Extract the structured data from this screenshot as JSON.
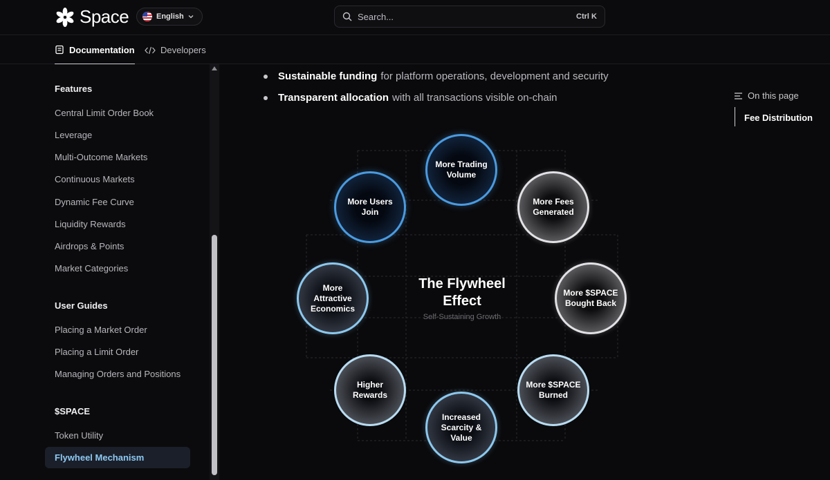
{
  "header": {
    "logo_text": "Space",
    "language": "English",
    "search_placeholder": "Search...",
    "search_shortcut": "Ctrl K"
  },
  "nav_tabs": [
    {
      "label": "Documentation",
      "active": true
    },
    {
      "label": "Developers",
      "active": false
    }
  ],
  "sidebar": {
    "sections": [
      {
        "title": "Features",
        "items": [
          "Central Limit Order Book",
          "Leverage",
          "Multi-Outcome Markets",
          "Continuous Markets",
          "Dynamic Fee Curve",
          "Liquidity Rewards",
          "Airdrops & Points",
          "Market Categories"
        ]
      },
      {
        "title": "User Guides",
        "items": [
          "Placing a Market Order",
          "Placing a Limit Order",
          "Managing Orders and Positions"
        ]
      },
      {
        "title": "$SPACE",
        "items": [
          "Token Utility",
          "Flywheel Mechanism"
        ]
      }
    ],
    "active_item": "Flywheel Mechanism"
  },
  "content": {
    "bullets": [
      {
        "bold": "Sustainable funding",
        "rest": "for platform operations, development and security"
      },
      {
        "bold": "Transparent allocation",
        "rest": "with all transactions visible on-chain"
      }
    ],
    "flywheel": {
      "title_line1": "The Flywheel",
      "title_line2": "Effect",
      "subtitle": "Self-Sustaining Growth",
      "nodes": [
        {
          "label": "More Trading Volume"
        },
        {
          "label": "More Fees Generated"
        },
        {
          "label": "More $SPACE Bought Back"
        },
        {
          "label": "More $SPACE Burned"
        },
        {
          "label": "Increased Scarcity & Value"
        },
        {
          "label": "Higher Rewards"
        },
        {
          "label": "More Attractive Economics"
        },
        {
          "label": "More Users Join"
        }
      ]
    }
  },
  "toc": {
    "heading": "On this page",
    "items": [
      "Fee Distribution"
    ]
  },
  "colors": {
    "accent_blue": "#4a9be0",
    "active_link": "#8ec9f3",
    "background": "#0a0a0c"
  }
}
